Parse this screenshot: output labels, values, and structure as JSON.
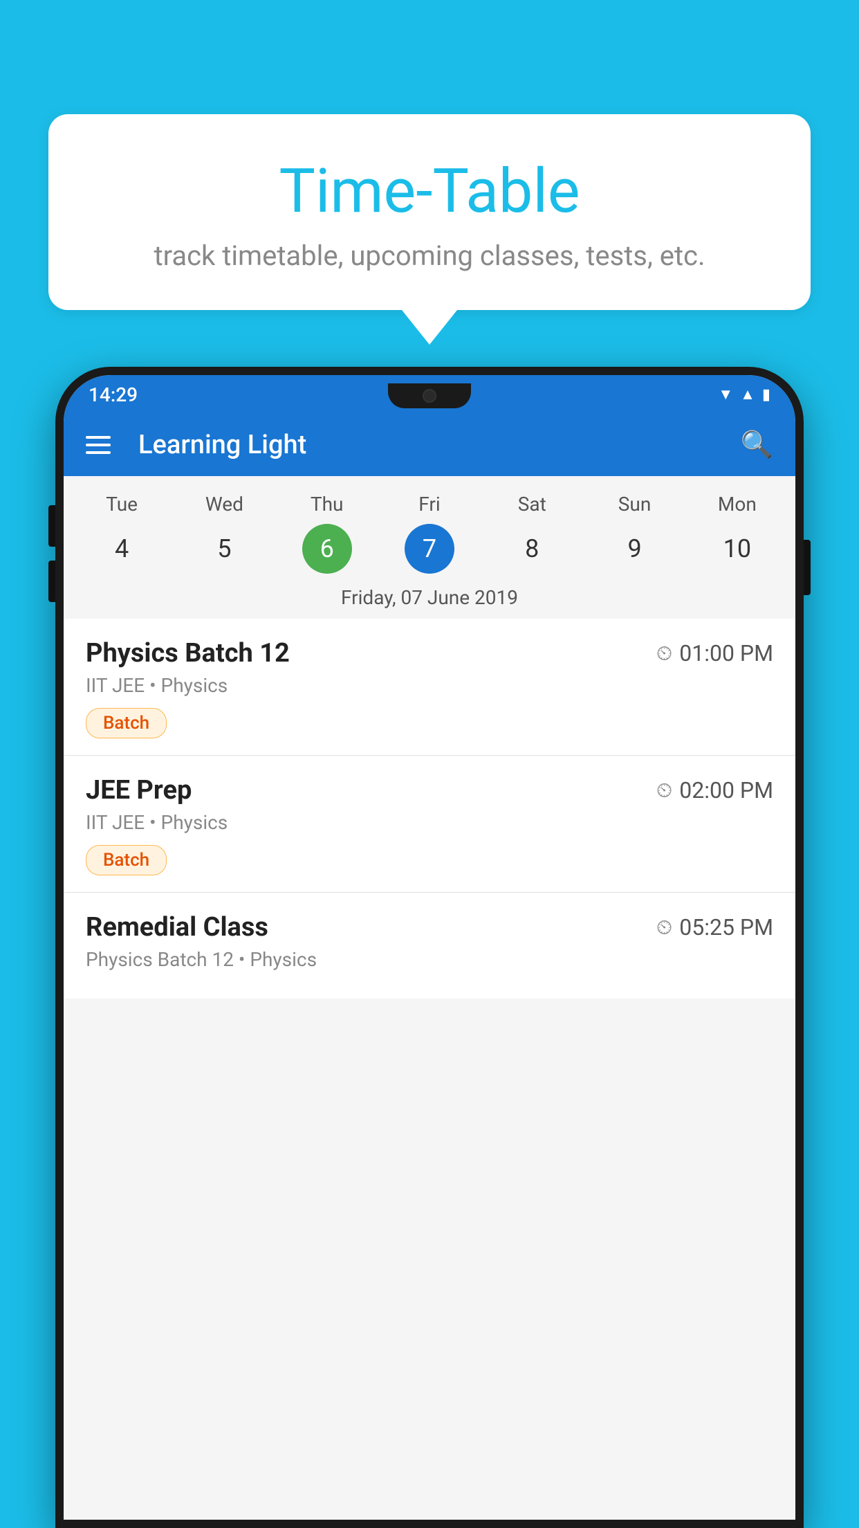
{
  "background_color": "#1BBDE8",
  "speech_bubble": {
    "title": "Time-Table",
    "subtitle": "track timetable, upcoming classes, tests, etc."
  },
  "app": {
    "name": "Learning Light",
    "status_bar": {
      "time": "14:29"
    }
  },
  "calendar": {
    "days": [
      {
        "name": "Tue",
        "number": "4",
        "state": "normal"
      },
      {
        "name": "Wed",
        "number": "5",
        "state": "normal"
      },
      {
        "name": "Thu",
        "number": "6",
        "state": "today"
      },
      {
        "name": "Fri",
        "number": "7",
        "state": "selected"
      },
      {
        "name": "Sat",
        "number": "8",
        "state": "normal"
      },
      {
        "name": "Sun",
        "number": "9",
        "state": "normal"
      },
      {
        "name": "Mon",
        "number": "10",
        "state": "normal"
      }
    ],
    "selected_date_label": "Friday, 07 June 2019"
  },
  "schedule": {
    "items": [
      {
        "title": "Physics Batch 12",
        "time": "01:00 PM",
        "subtitle": "IIT JEE • Physics",
        "tag": "Batch"
      },
      {
        "title": "JEE Prep",
        "time": "02:00 PM",
        "subtitle": "IIT JEE • Physics",
        "tag": "Batch"
      },
      {
        "title": "Remedial Class",
        "time": "05:25 PM",
        "subtitle": "Physics Batch 12 • Physics",
        "tag": ""
      }
    ]
  }
}
